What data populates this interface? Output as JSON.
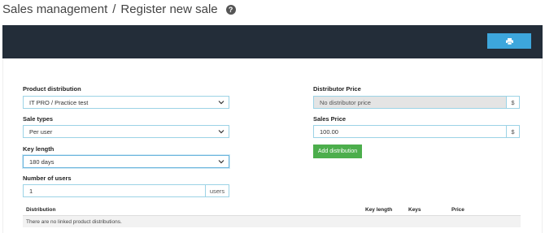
{
  "header": {
    "section": "Sales management",
    "separator": "/",
    "title": "Register new sale",
    "help_icon": "?"
  },
  "form": {
    "product_distribution": {
      "label": "Product distribution",
      "value": "IT PRO / Practice test"
    },
    "sale_types": {
      "label": "Sale types",
      "value": "Per user"
    },
    "key_length": {
      "label": "Key length",
      "value": "180 days"
    },
    "number_of_users": {
      "label": "Number of users",
      "value": "1",
      "unit": "users"
    },
    "distributor_price": {
      "label": "Distributor Price",
      "value": "No distributor price",
      "unit": "$"
    },
    "sales_price": {
      "label": "Sales Price",
      "value": "100.00",
      "unit": "$"
    },
    "add_button": "Add distribution"
  },
  "table": {
    "columns": [
      "Distribution",
      "Key length",
      "Keys",
      "Price"
    ],
    "empty_message": "There are no linked product distributions."
  },
  "colors": {
    "toolbar": "#232d39",
    "print_button": "#3da6dc",
    "add_button": "#4cae4c",
    "input_border": "#9cd3e6"
  },
  "icons": {
    "print": "print-icon",
    "help": "help-icon",
    "chevron": "chevron-down-icon"
  }
}
